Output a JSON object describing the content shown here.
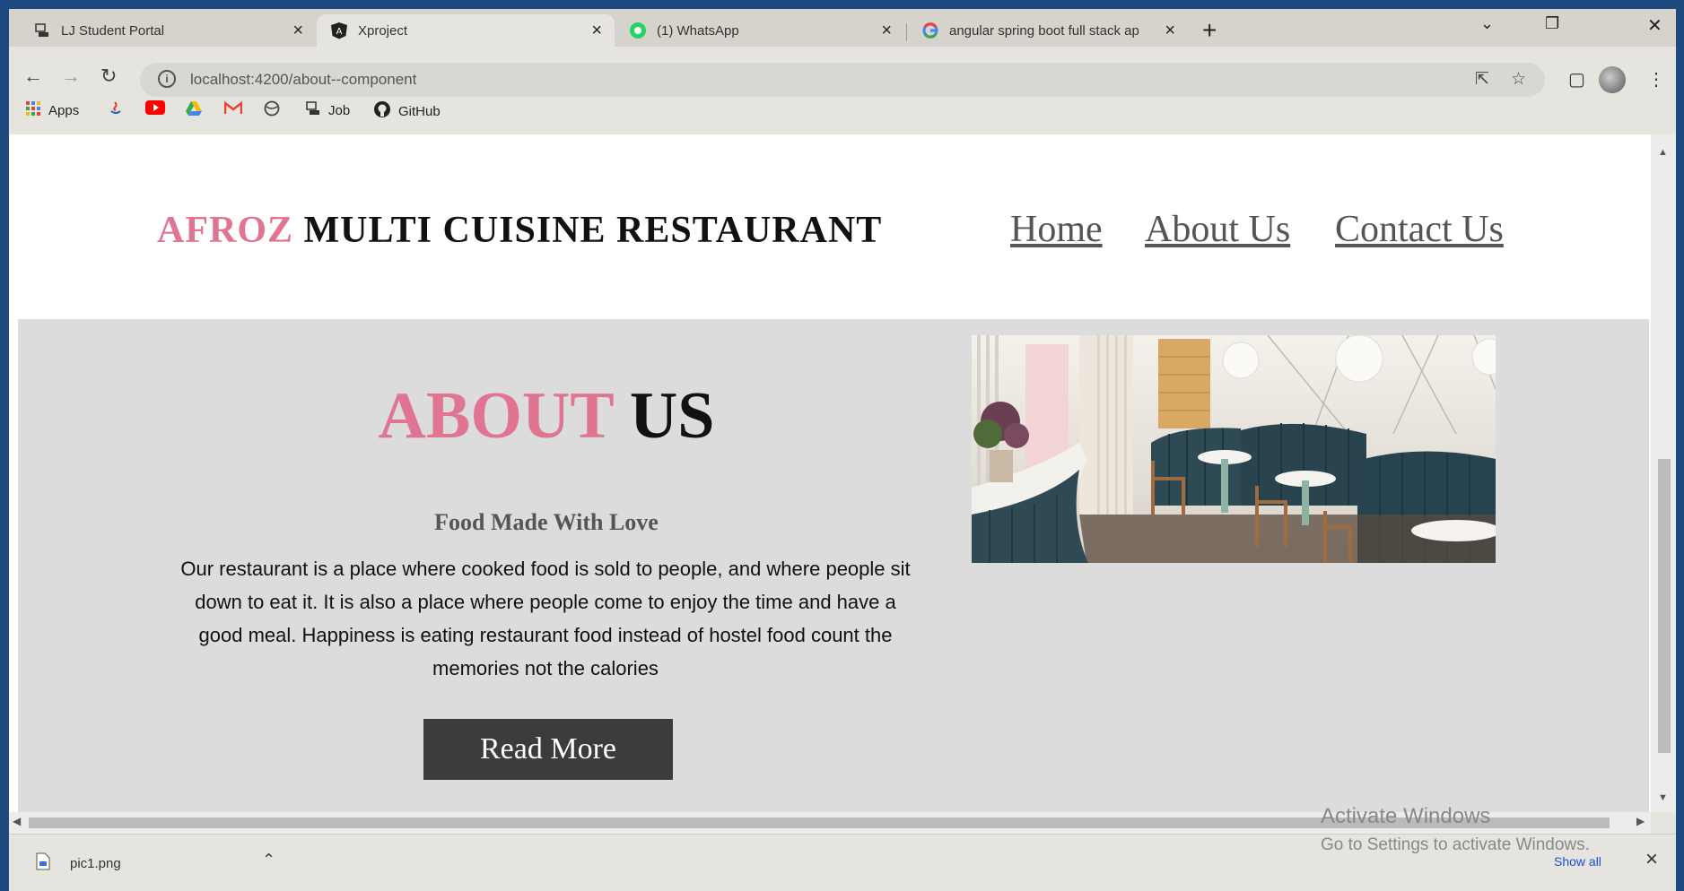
{
  "browser": {
    "tabs": [
      {
        "label": "LJ Student Portal",
        "icon": "portal-icon"
      },
      {
        "label": "Xproject",
        "icon": "angular-icon"
      },
      {
        "label": "(1) WhatsApp",
        "icon": "whatsapp-icon"
      },
      {
        "label": "angular spring boot full stack ap",
        "icon": "google-icon"
      }
    ],
    "url": "localhost:4200/about--component",
    "bookmarks": [
      {
        "label": "Apps",
        "icon": "apps-grid-icon"
      },
      {
        "label": "",
        "icon": "java-icon"
      },
      {
        "label": "",
        "icon": "youtube-icon"
      },
      {
        "label": "",
        "icon": "google-drive-icon"
      },
      {
        "label": "",
        "icon": "gmail-icon"
      },
      {
        "label": "",
        "icon": "globe-icon"
      },
      {
        "label": "Job",
        "icon": "job-icon"
      },
      {
        "label": "GitHub",
        "icon": "github-icon"
      }
    ]
  },
  "page": {
    "brand": {
      "accent": "AFROZ",
      "rest": "MULTI CUISINE RESTAURANT"
    },
    "nav": [
      "Home",
      "About Us",
      "Contact Us"
    ],
    "about": {
      "title_accent": "ABOUT",
      "title_rest": "US",
      "subtitle": "Food Made With Love",
      "description": "Our restaurant is a place where cooked food is sold to people, and where people sit down to eat it. It is also a place where people come to enjoy the time and have a good meal. Happiness is eating restaurant food instead of hostel food count the memories not the calories",
      "button": "Read More"
    },
    "colors": {
      "accent": "#e07591",
      "section_bg": "#dcdcdc",
      "button_bg": "#3c3c3c"
    }
  },
  "overlay": {
    "activate_title": "Activate Windows",
    "activate_sub": "Go to Settings to activate Windows."
  },
  "download_bar": {
    "file": "pic1.png",
    "show_all": "Show all"
  }
}
